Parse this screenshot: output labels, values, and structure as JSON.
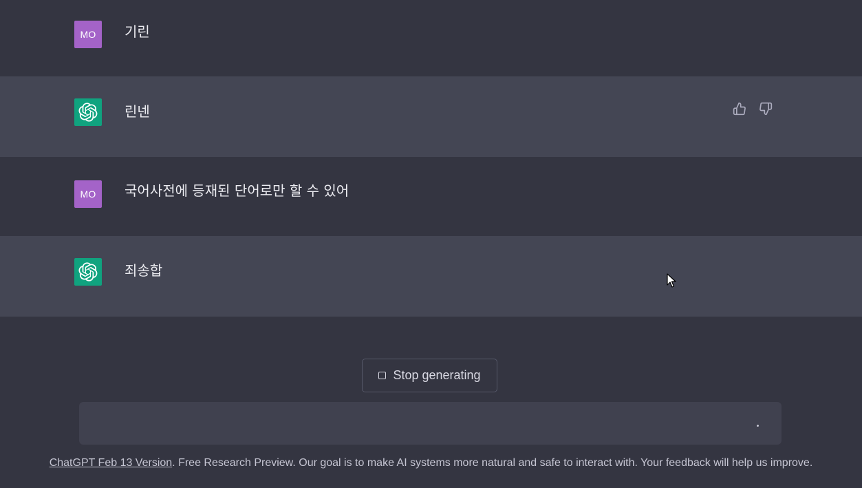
{
  "conversation": [
    {
      "role": "user",
      "avatar_label": "MO",
      "text": "기린"
    },
    {
      "role": "assistant",
      "avatar_icon": "openai-logo-icon",
      "text": "린넨"
    },
    {
      "role": "user",
      "avatar_label": "MO",
      "text": "국어사전에 등재된 단어로만 할 수 있어"
    },
    {
      "role": "assistant",
      "avatar_icon": "openai-logo-icon",
      "text": "죄송합"
    }
  ],
  "controls": {
    "stop_label": "Stop generating",
    "input_value": ""
  },
  "footer": {
    "link_text": "ChatGPT Feb 13 Version",
    "text": ". Free Research Preview. Our goal is to make AI systems more natural and safe to interact with. Your feedback will help us improve."
  },
  "colors": {
    "background": "#343541",
    "assistant_row": "#444654",
    "user_avatar": "#a463c8",
    "assistant_avatar": "#10a37f"
  }
}
